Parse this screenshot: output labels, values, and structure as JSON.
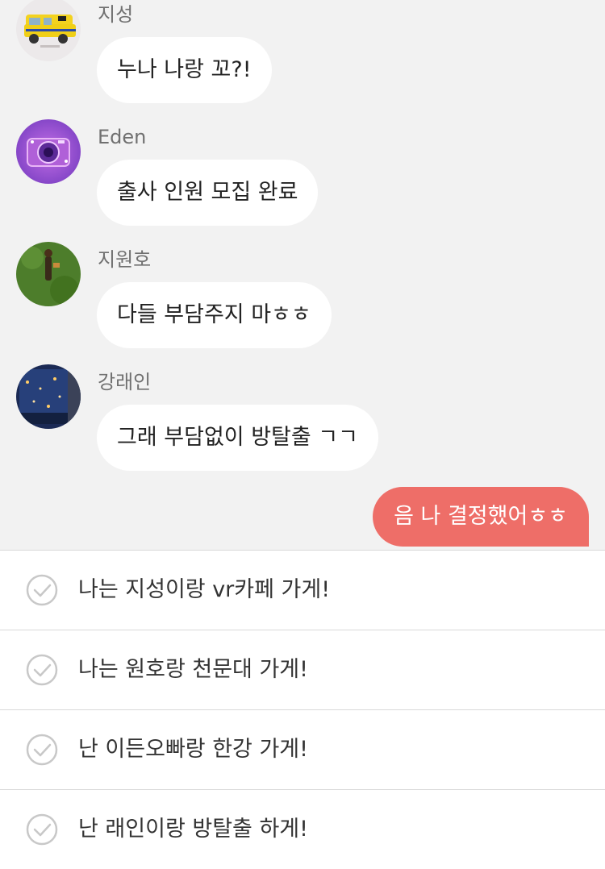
{
  "messages": [
    {
      "sender": "지성",
      "text": "누나 나랑 꼬?!",
      "avatar": "ambulance-toy-avatar"
    },
    {
      "sender": "Eden",
      "text": "출사 인원 모집 완료",
      "avatar": "camera-purple-avatar"
    },
    {
      "sender": "지원호",
      "text": "다들 부담주지 마ㅎㅎ",
      "avatar": "grass-field-avatar"
    },
    {
      "sender": "강래인",
      "text": "그래 부담없이 방탈출 ㄱㄱ",
      "avatar": "night-window-avatar"
    }
  ],
  "my_message": {
    "text": "음 나 결정했어ㅎㅎ"
  },
  "options": [
    {
      "label": "나는 지성이랑 vr카페 가게!"
    },
    {
      "label": "나는 원호랑 천문대 가게!"
    },
    {
      "label": "난 이든오빠랑 한강 가게!"
    },
    {
      "label": "난 래인이랑 방탈출 하게!"
    }
  ],
  "colors": {
    "chat_background": "#f2f2f2",
    "my_bubble": "#ee6e68",
    "other_bubble": "#ffffff",
    "check_icon": "#c8c8c8"
  }
}
